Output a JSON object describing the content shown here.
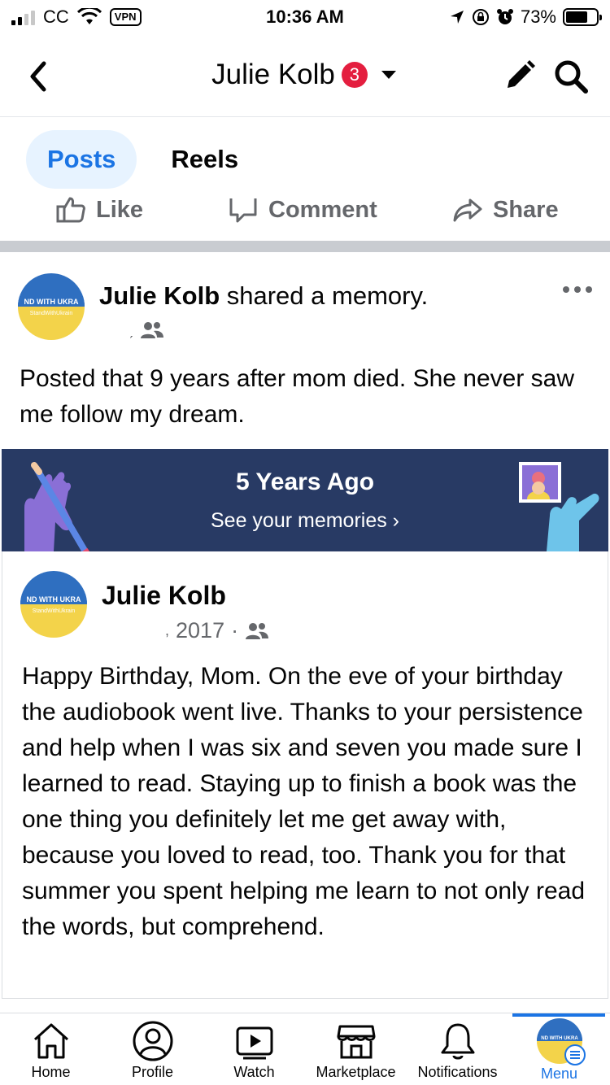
{
  "status_bar": {
    "carrier": "CC",
    "vpn": "VPN",
    "time": "10:36 AM",
    "battery": "73%",
    "battery_level": 0.73
  },
  "header": {
    "title": "Julie Kolb",
    "badge_count": "3"
  },
  "tabs": [
    {
      "label": "Posts",
      "active": true
    },
    {
      "label": "Reels",
      "active": false
    }
  ],
  "actions": {
    "like": "Like",
    "comment": "Comment",
    "share": "Share"
  },
  "post": {
    "author": "Julie Kolb",
    "action_text": " shared a memory.",
    "meta_mark": "ˏ",
    "text": "Posted that 9 years after mom died. She never saw me follow my dream."
  },
  "memory_banner": {
    "title": "5 Years Ago",
    "link": "See your memories ›"
  },
  "shared": {
    "author": "Julie Kolb",
    "date": "2017",
    "meta_mark": ",",
    "text": "Happy Birthday, Mom. On the eve of your birthday the audiobook went live. Thanks to your persistence and help when I was six and seven you made sure I learned to read. Staying up to finish a book was the one thing you definitely let me get away with, because you loved to read, too. Thank you for that summer you spent helping me learn to not only read the words, but comprehend."
  },
  "avatar": {
    "top_text": "ND WITH UKRA",
    "bottom_text": "StandWithUkrain",
    "colors": {
      "blue": "#2f6fc0",
      "yellow": "#f3d34a"
    }
  },
  "nav": [
    {
      "label": "Home",
      "icon": "home-icon"
    },
    {
      "label": "Profile",
      "icon": "profile-icon"
    },
    {
      "label": "Watch",
      "icon": "watch-icon"
    },
    {
      "label": "Marketplace",
      "icon": "marketplace-icon"
    },
    {
      "label": "Notifications",
      "icon": "bell-icon"
    },
    {
      "label": "Menu",
      "icon": "menu-avatar-icon",
      "active": true
    }
  ],
  "colors": {
    "accent": "#1b74e4",
    "badge": "#e41e3f",
    "banner": "#283a64",
    "secondary_text": "#65676b"
  }
}
